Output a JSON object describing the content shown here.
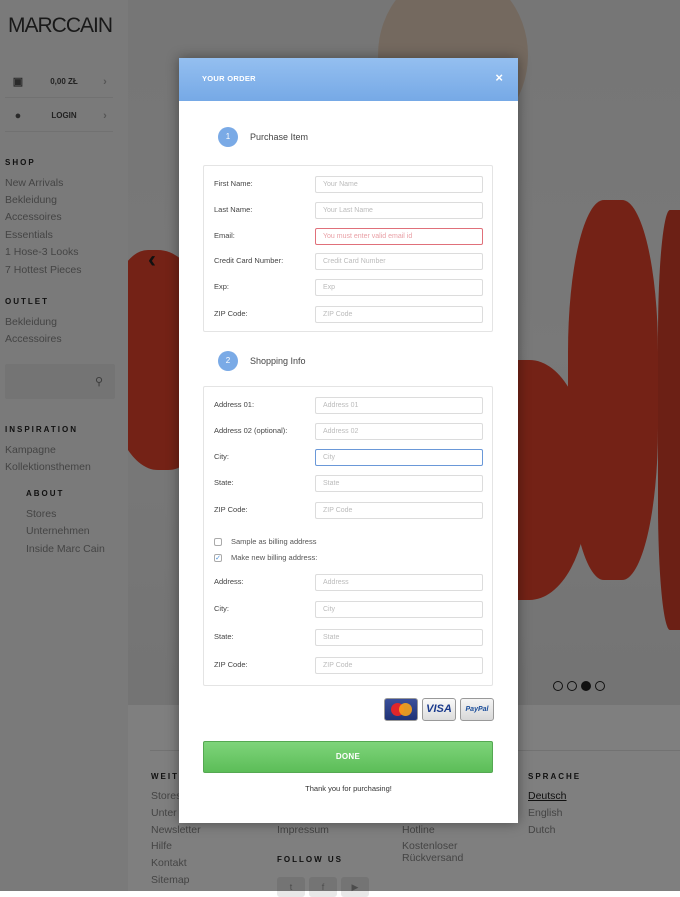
{
  "sidebar": {
    "logo": "MARCCAIN",
    "cart_label": "0,00 ZŁ",
    "login_label": "LOGIN",
    "shop_heading": "SHOP",
    "shop_items": [
      "New Arrivals",
      "Bekleidung",
      "Accessoires",
      "Essentials",
      "1 Hose-3 Looks",
      "7 Hottest Pieces"
    ],
    "outlet_heading": "OUTLET",
    "outlet_items": [
      "Bekleidung",
      "Accessoires"
    ],
    "inspiration_heading": "INSPIRATION",
    "inspiration_items": [
      "Kampagne",
      "Kollektionsthemen"
    ],
    "about_heading": "ABOUT",
    "about_items": [
      "Stores",
      "Unternehmen",
      "Inside Marc Cain"
    ]
  },
  "footer": {
    "col1_heading": "WEIT",
    "col1_items": [
      "Stores",
      "Unter",
      "Newsletter",
      "Hilfe",
      "Kontakt",
      "Sitemap"
    ],
    "col2_items": [
      "Impressum"
    ],
    "follow_heading": "FOLLOW US",
    "col3_items": [
      "Hotline",
      "Kostenloser",
      "Rückversand"
    ],
    "lang_heading": "SPRACHE",
    "lang_items": [
      "Deutsch",
      "English",
      "Dutch"
    ]
  },
  "modal": {
    "title": "YOUR ORDER",
    "close": "×",
    "step1": {
      "num": "1",
      "label": "Purchase Item"
    },
    "step2": {
      "num": "2",
      "label": "Shopping Info"
    },
    "purchase_fields": [
      {
        "label": "First Name:",
        "placeholder": "Your Name"
      },
      {
        "label": "Last Name:",
        "placeholder": "Your Last Name"
      },
      {
        "label": "Email:",
        "placeholder": "You must enter valid email id"
      },
      {
        "label": "Credit Card Number:",
        "placeholder": "Credit Card Number"
      },
      {
        "label": "Exp:",
        "placeholder": "Exp"
      },
      {
        "label": "ZIP Code:",
        "placeholder": "ZIP Code"
      }
    ],
    "shipping_fields": [
      {
        "label": "Address 01:",
        "placeholder": "Address 01"
      },
      {
        "label": "Address 02 (optional):",
        "placeholder": "Address 02"
      },
      {
        "label": "City:",
        "placeholder": "City"
      },
      {
        "label": "State:",
        "placeholder": "State"
      },
      {
        "label": "ZIP Code:",
        "placeholder": "ZIP Code"
      }
    ],
    "checkbox_same": {
      "label": "Sample as billing address",
      "checked": false
    },
    "checkbox_new": {
      "label": "Make new billing address:",
      "checked": true,
      "mark": "✓"
    },
    "billing_fields": [
      {
        "label": "Address:",
        "placeholder": "Address"
      },
      {
        "label": "City:",
        "placeholder": "City"
      },
      {
        "label": "State:",
        "placeholder": "State"
      },
      {
        "label": "ZIP Code:",
        "placeholder": "ZIP Code"
      }
    ],
    "cards": {
      "visa": "VISA",
      "paypal": "PayPal"
    },
    "done_label": "DONE",
    "thanks": "Thank you for purchasing!"
  },
  "colors": {
    "header_blue": "#7aaae6",
    "done_green": "#5cbd58",
    "error_red": "#e0707a",
    "accent_red": "#e8452c"
  }
}
